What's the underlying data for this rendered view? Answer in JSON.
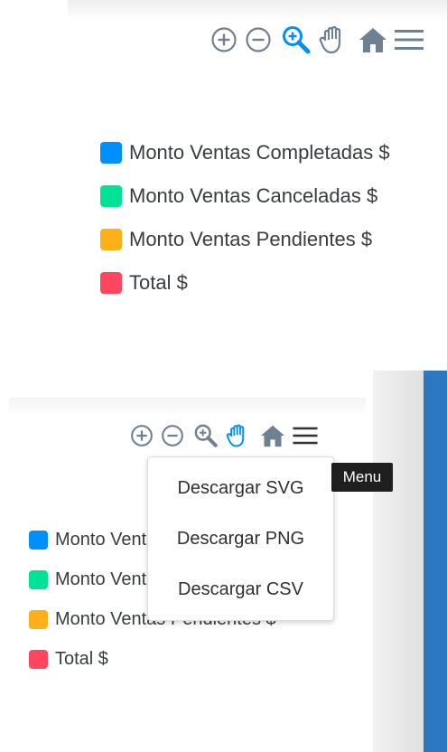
{
  "colors": {
    "toolbar_gray": "#6e8192",
    "toolbar_active": "#008ffb",
    "series_completed": "#008ffb",
    "series_cancelled": "#00e396",
    "series_pending": "#feb019",
    "series_total": "#ff4560",
    "side_bar_blue": "#2b77c0"
  },
  "toolbar_icons": [
    "zoom-in-icon",
    "zoom-out-icon",
    "magnifier-icon",
    "pan-hand-icon",
    "home-icon",
    "menu-hamburger-icon"
  ],
  "legend": {
    "items": [
      {
        "label": "Monto Ventas Completadas $",
        "color": "#008ffb"
      },
      {
        "label": "Monto Ventas Canceladas $",
        "color": "#00e396"
      },
      {
        "label": "Monto Ventas Pendientes $",
        "color": "#feb019"
      },
      {
        "label": "Total $",
        "color": "#ff4560"
      }
    ]
  },
  "export_menu": {
    "items": [
      {
        "label": "Descargar SVG"
      },
      {
        "label": "Descargar PNG"
      },
      {
        "label": "Descargar CSV"
      }
    ]
  },
  "tooltip": {
    "text": "Menu"
  }
}
